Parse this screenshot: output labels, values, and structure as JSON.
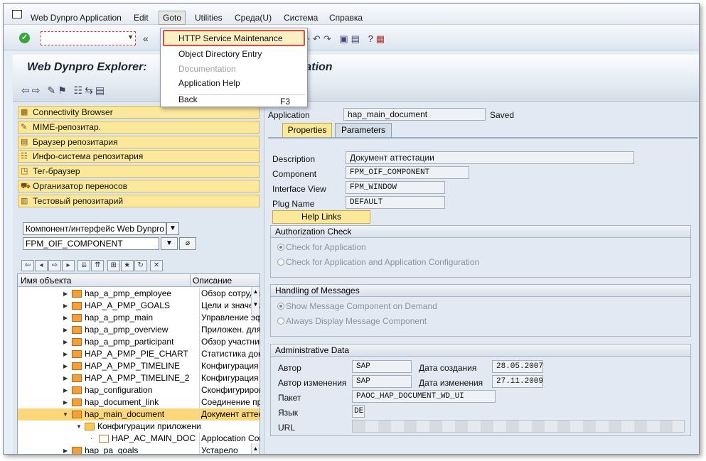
{
  "menubar": {
    "items": [
      {
        "label": "Web Dynpro Application"
      },
      {
        "label": "Edit"
      },
      {
        "label": "Goto"
      },
      {
        "label": "Utilities"
      },
      {
        "label": "Среда(U)"
      },
      {
        "label": "Система"
      },
      {
        "label": "Справка"
      }
    ]
  },
  "toolbar": {
    "command_value": "",
    "double_arrow": "«"
  },
  "window_title": "Web Dynpro Explorer: Display Web Dynpro Application",
  "window_title_left": "Web Dynpro Explorer:",
  "window_title_right": "ication",
  "goto_menu": {
    "items": [
      {
        "label": "HTTP Service Maintenance",
        "state": "highlighted"
      },
      {
        "label": "Object Directory Entry",
        "state": "enabled"
      },
      {
        "label": "Documentation",
        "state": "disabled"
      },
      {
        "label": "Application Help",
        "state": "enabled"
      },
      {
        "label": "Back",
        "state": "enabled",
        "shortcut": "F3"
      }
    ]
  },
  "nav_buttons": [
    {
      "label": "Connectivity Browser"
    },
    {
      "label": "MIME-репозитар."
    },
    {
      "label": "Браузер репозитария"
    },
    {
      "label": "Инфо-система репозитария"
    },
    {
      "label": "Тег-браузер"
    },
    {
      "label": "Организатор переносов"
    },
    {
      "label": "Тестовый репозитарий"
    }
  ],
  "object_selector": {
    "type_value": "Компонент/интерфейс Web Dynpro",
    "name_value": "FPM_OIF_COMPONENT"
  },
  "tree": {
    "columns": {
      "name": "Имя объекта",
      "desc": "Описание"
    },
    "rows": [
      {
        "name": "hap_a_pmp_employee",
        "desc": "Обзор сотрудник"
      },
      {
        "name": "HAP_A_PMP_GOALS",
        "desc": "Цели и значения"
      },
      {
        "name": "hap_a_pmp_main",
        "desc": "Управление эф"
      },
      {
        "name": "hap_a_pmp_overview",
        "desc": "Приложен. для"
      },
      {
        "name": "hap_a_pmp_participant",
        "desc": "Обзор участник"
      },
      {
        "name": "HAP_A_PMP_PIE_CHART",
        "desc": "Статистика доку"
      },
      {
        "name": "HAP_A_PMP_TIMELINE",
        "desc": "Конфигурация д"
      },
      {
        "name": "HAP_A_PMP_TIMELINE_2",
        "desc": "Конфигурация д"
      },
      {
        "name": "hap_configuration",
        "desc": "Сконфигуриров"
      },
      {
        "name": "hap_document_link",
        "desc": "Соединение пре"
      },
      {
        "name": "hap_main_document",
        "desc": "Документ аттес"
      },
      {
        "name": "Конфигурации приложени",
        "desc": ""
      },
      {
        "name": "HAP_AC_MAIN_DOC",
        "desc": "Applocation Con"
      },
      {
        "name": "hap_pa_goals",
        "desc": "Устарело"
      }
    ]
  },
  "detail": {
    "application_label": "Application",
    "application_value": "hap_main_document",
    "status": "Saved",
    "tabs": [
      {
        "label": "Properties"
      },
      {
        "label": "Parameters"
      }
    ],
    "description_label": "Description",
    "description_value": "Документ аттестации",
    "component_label": "Component",
    "component_value": "FPM_OIF_COMPONENT",
    "interface_view_label": "Interface View",
    "interface_view_value": "FPM_WINDOW",
    "plug_name_label": "Plug Name",
    "plug_name_value": "DEFAULT",
    "help_links": "Help Links",
    "auth_group": {
      "title": "Authorization Check",
      "opt1": "Check for Application",
      "opt2": "Check for Application and Application Configuration"
    },
    "messages_group": {
      "title": "Handling of Messages",
      "opt1": "Show Message Component on Demand",
      "opt2": "Always Display Message Component"
    },
    "admin_group": {
      "title": "Administrative Data",
      "author_label": "Автор",
      "author_value": "SAP",
      "created_label": "Дата создания",
      "created_value": "28.05.2007",
      "changed_by_label": "Автор изменения",
      "changed_by_value": "SAP",
      "changed_label": "Дата изменения",
      "changed_value": "27.11.2009",
      "package_label": "Пакет",
      "package_value": "PAOC_HAP_DOCUMENT_WD_UI",
      "language_label": "Язык",
      "language_value": "DE",
      "url_label": "URL"
    }
  }
}
